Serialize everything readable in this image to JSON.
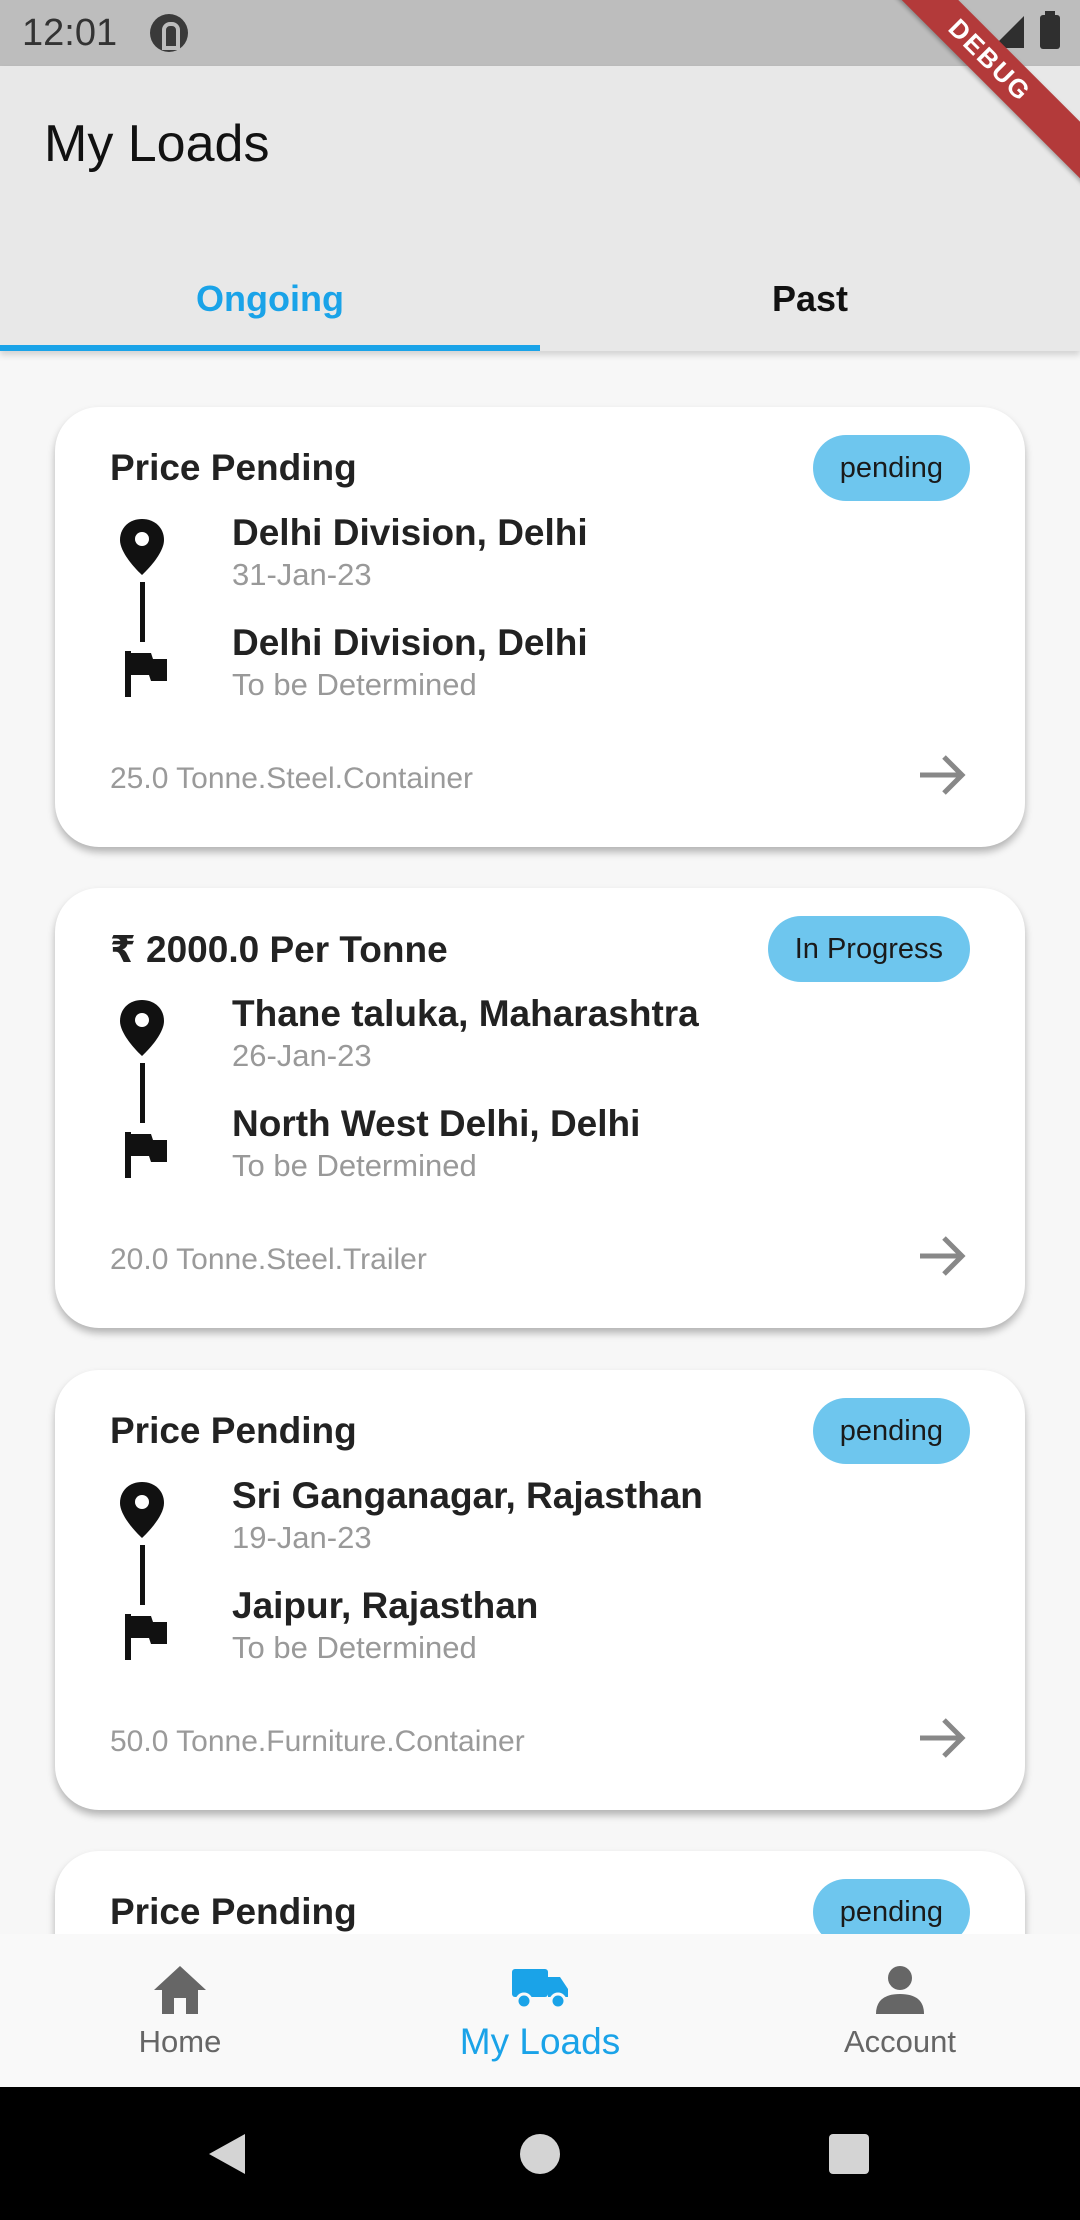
{
  "status_bar": {
    "time": "12:01"
  },
  "debug_label": "DEBUG",
  "header": {
    "title": "My Loads"
  },
  "tabs": [
    {
      "label": "Ongoing",
      "active": true
    },
    {
      "label": "Past",
      "active": false
    }
  ],
  "loads": [
    {
      "price": "Price Pending",
      "status": "pending",
      "origin": "Delhi Division, Delhi",
      "origin_date": "31-Jan-23",
      "destination": "Delhi Division, Delhi",
      "destination_date": "To be Determined",
      "details": "25.0 Tonne.Steel.Container"
    },
    {
      "price": "₹ 2000.0 Per Tonne",
      "status": "In Progress",
      "origin": "Thane taluka, Maharashtra",
      "origin_date": "26-Jan-23",
      "destination": "North West Delhi, Delhi",
      "destination_date": "To be Determined",
      "details": "20.0 Tonne.Steel.Trailer"
    },
    {
      "price": "Price Pending",
      "status": "pending",
      "origin": "Sri Ganganagar, Rajasthan",
      "origin_date": "19-Jan-23",
      "destination": "Jaipur, Rajasthan",
      "destination_date": "To be Determined",
      "details": "50.0 Tonne.Furniture.Container"
    },
    {
      "price": "Price Pending",
      "status": "pending"
    }
  ],
  "bottom_nav": [
    {
      "label": "Home",
      "icon": "home-icon",
      "active": false
    },
    {
      "label": "My Loads",
      "icon": "truck-icon",
      "active": true
    },
    {
      "label": "Account",
      "icon": "person-icon",
      "active": false
    }
  ],
  "colors": {
    "accent": "#1aa3e8",
    "badge": "#6ec6ee",
    "debug": "#b33a3a"
  }
}
